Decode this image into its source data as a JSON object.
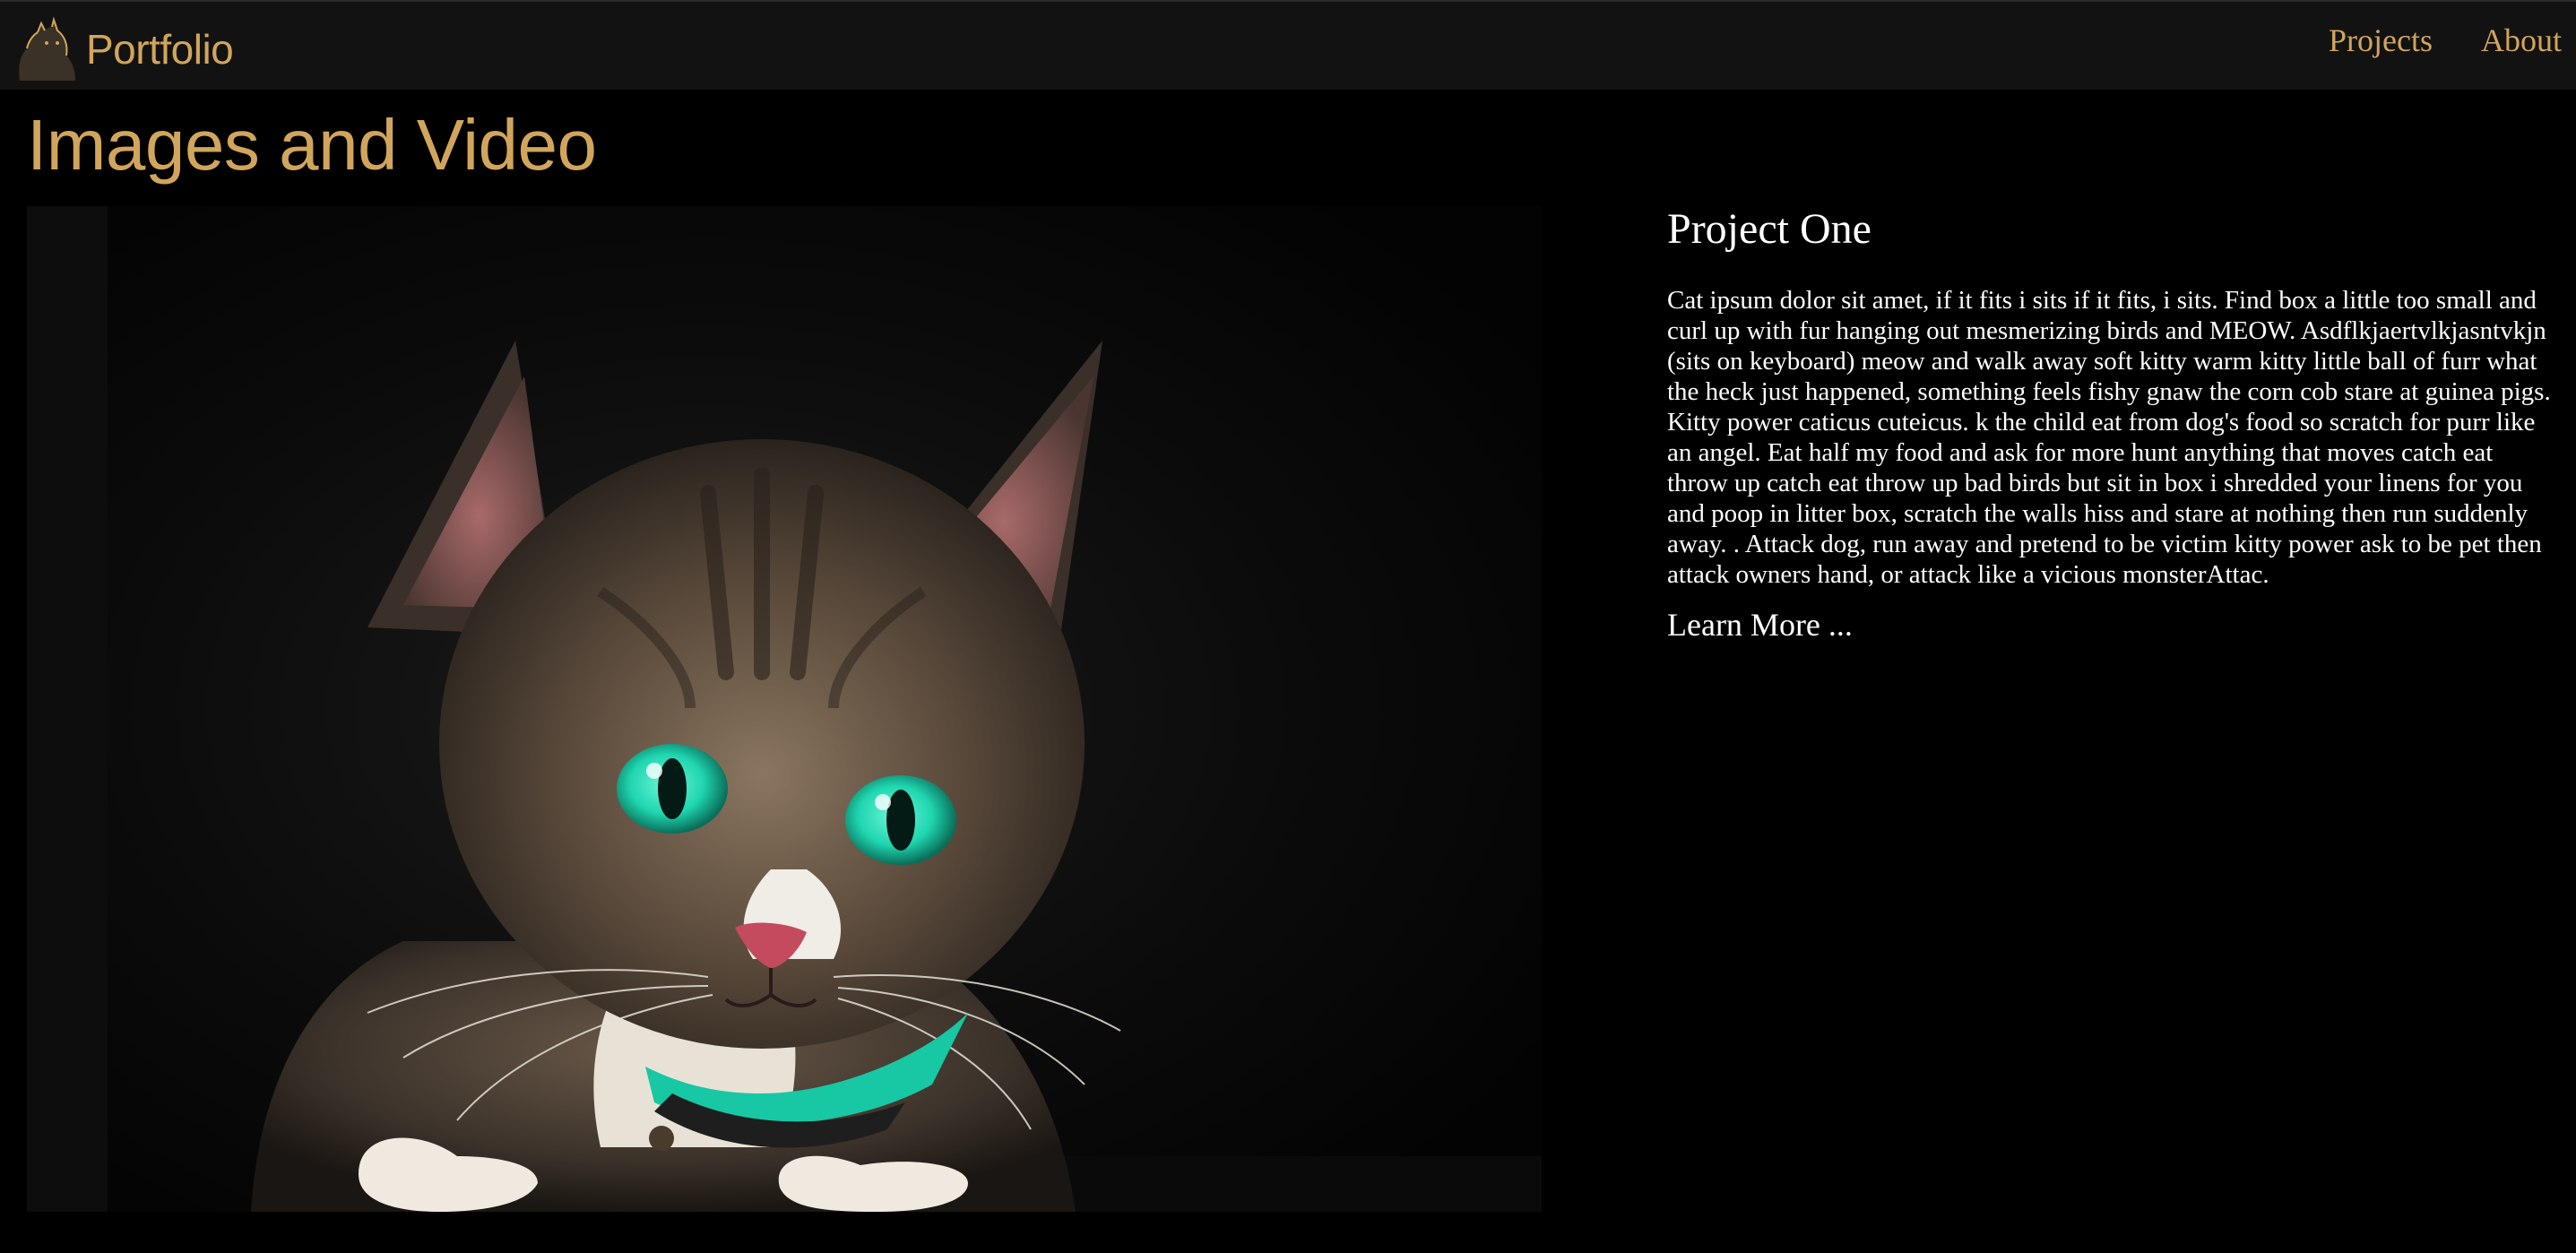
{
  "nav": {
    "brand": "Portfolio",
    "links": [
      "Projects",
      "About"
    ]
  },
  "page": {
    "title": "Images and Video"
  },
  "project": {
    "title": "Project One",
    "body": "Cat ipsum dolor sit amet, if it fits i sits if it fits, i sits. Find box a little too small and curl up with fur hanging out mesmerizing birds and MEOW. Asdflkjaertvlkjasntvkjn (sits on keyboard) meow and walk away soft kitty warm kitty little ball of furr what the heck just happened, something feels fishy gnaw the corn cob stare at guinea pigs. Kitty power caticus cuteicus. k the child eat from dog's food so scratch for purr like an angel. Eat half my food and ask for more hunt anything that moves catch eat throw up catch eat throw up bad birds but sit in box i shredded your linens for you and poop in litter box, scratch the walls hiss and stare at nothing then run suddenly away. . Attack dog, run away and pretend to be victim kitty power ask to be pet then attack owners hand, or attack like a vicious monsterAttac.",
    "link": "Learn More ..."
  },
  "colors": {
    "accent": "#d1a55c",
    "background": "#000000",
    "navbar": "#121212",
    "eyes": "#1fd6b0",
    "collar": "#18c7a4"
  },
  "icons": {
    "brand": "cat-logo-icon"
  },
  "media": {
    "subject": "tabby cat with green eyes"
  }
}
